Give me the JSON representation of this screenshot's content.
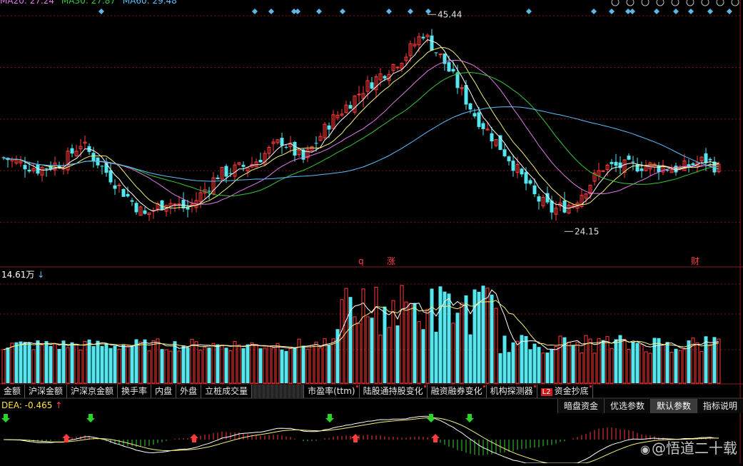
{
  "ma_legend": {
    "ma20_text": "MA20: 27.24",
    "ma30_text": "MA30: 27.87",
    "ma60_text": "MA60: 29.48"
  },
  "colors": {
    "up": "#ff3c3c",
    "down": "#54e7f0",
    "ma5": "#ffffff",
    "ma10": "#f5f07a",
    "ma20": "#e27ae8",
    "ma30": "#38c838",
    "ma60": "#5bc1ff",
    "grid": "#7a1515"
  },
  "chart_data": [
    {
      "type": "candlestick",
      "name": "price",
      "annotations": [
        {
          "text": "45.44",
          "kind": "high"
        },
        {
          "text": "24.15",
          "kind": "low"
        },
        {
          "text": "q",
          "kind": "event"
        },
        {
          "text": "涨",
          "kind": "event"
        },
        {
          "text": "财",
          "kind": "event"
        }
      ],
      "ylim": [
        18,
        48
      ]
    },
    {
      "type": "bar",
      "name": "volume",
      "label": "14.61万"
    },
    {
      "type": "bar",
      "name": "macd",
      "label": "DEA: -0.465"
    }
  ],
  "tabs": [
    {
      "label": "金额"
    },
    {
      "label": "沪深金额"
    },
    {
      "label": "沪深京金额"
    },
    {
      "label": "换手率"
    },
    {
      "label": "内盘"
    },
    {
      "label": "外盘"
    },
    {
      "label": "立桩成交量"
    },
    {
      "label": ""
    },
    {
      "label": "市盈率(ttm)"
    },
    {
      "label": "陆股通持股变化"
    },
    {
      "label": "融资融券变化"
    },
    {
      "label": "机构探测器"
    },
    {
      "label": "资金抄底",
      "badge": "L2"
    }
  ],
  "buttons": [
    {
      "label": "暗盘资金"
    },
    {
      "label": "优选参数"
    },
    {
      "label": "默认参数"
    },
    {
      "label": "指标说明"
    }
  ],
  "watermark": "@悟道二十载"
}
